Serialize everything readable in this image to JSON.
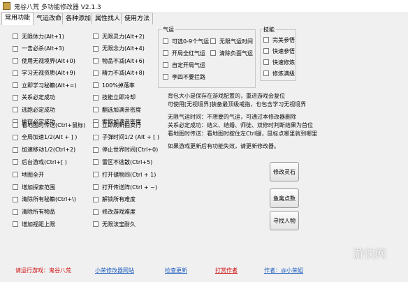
{
  "window": {
    "title": "鬼谷八荒 多功能修改器  V2.1.3"
  },
  "tabs": [
    "常用功能",
    "气运改命",
    "各种添加",
    "属性找人",
    "使用方法"
  ],
  "col1_top": [
    "无限体力(Alt+1)",
    "一击必杀(Alt+3)",
    "使用无视境界(Alt+0)",
    "学习无视资质(Alt+9)",
    "立即学习秘籍(Alt+=)",
    "关系必定成功",
    "逃跑必定成功",
    "偷窃必定成功"
  ],
  "col2_top": [
    "无限灵力(Alt+2)",
    "无限念力(Alt+4)",
    "物品不减(Alt+6)",
    "精力不减(Alt+8)",
    "100%掉落率",
    "技能立即冷却",
    "翻选加满亲密度",
    "索取加满亲密度"
  ],
  "col1_bottom": [
    "看地图时传送(Ctrl+鼠标)",
    "全局加速1/2(Alt + ] )",
    "加速移动1/2(Ctrl+2)",
    "后台游戏(Ctrl+[ )",
    "地图全开",
    "增加探索范围",
    "清除所有秘籍(Ctrl+\\)",
    "清除所有物品",
    "增加视距上限"
  ],
  "col2_bottom": [
    "立即刷新拍卖行",
    "子弹时间1/2 (Alt + [ )",
    "停止世界时间(Ctrl+0)",
    "雷区不逃散(Ctrl+5)",
    "打开储物间(Ctrl + 1)",
    "打开传送阵(Ctrl + ~)",
    "解锁所有难度",
    "修改游戏难度",
    "无限法宝耐久"
  ],
  "qiyun": {
    "title": "气运",
    "left": [
      "可选0-9个气运",
      "开局全红气运",
      "自定开局气运",
      "李四不要拦路"
    ],
    "right": [
      "无限气运时间",
      "清除负面气运"
    ]
  },
  "jineng": {
    "title": "技能",
    "items": [
      "完美参悟",
      "快速参悟",
      "快速修炼",
      "修炼满级"
    ]
  },
  "notes": {
    "n1": "背包大小是保存在游戏配置的，重进游戏会复位",
    "n2": "可使用[无视境界]装备最顶级戒指，也包含学习无视境界",
    "n3": "无限气运时间：不想要的气运，可通过本修改器删除",
    "n4": "关系必定成功：结义、结婚、师徒、双修时判断结果为首位",
    "n5": "看地图时传送：看地图时按住左Ctrl键，鼠标点哪里就到哪里",
    "n6": "如果游戏更新后有功能失效，请更新修改器。"
  },
  "buttons": {
    "b1": "修改灵石",
    "b2": "鱼禽点数",
    "b3": "寻找人物"
  },
  "footer": {
    "running": "请运行游戏：鬼谷八荒",
    "site": "小荣修改器网站",
    "update": "检查更新",
    "donate": "打赏作者",
    "author": "作者：@小荣姐"
  },
  "watermark": "游侠网"
}
